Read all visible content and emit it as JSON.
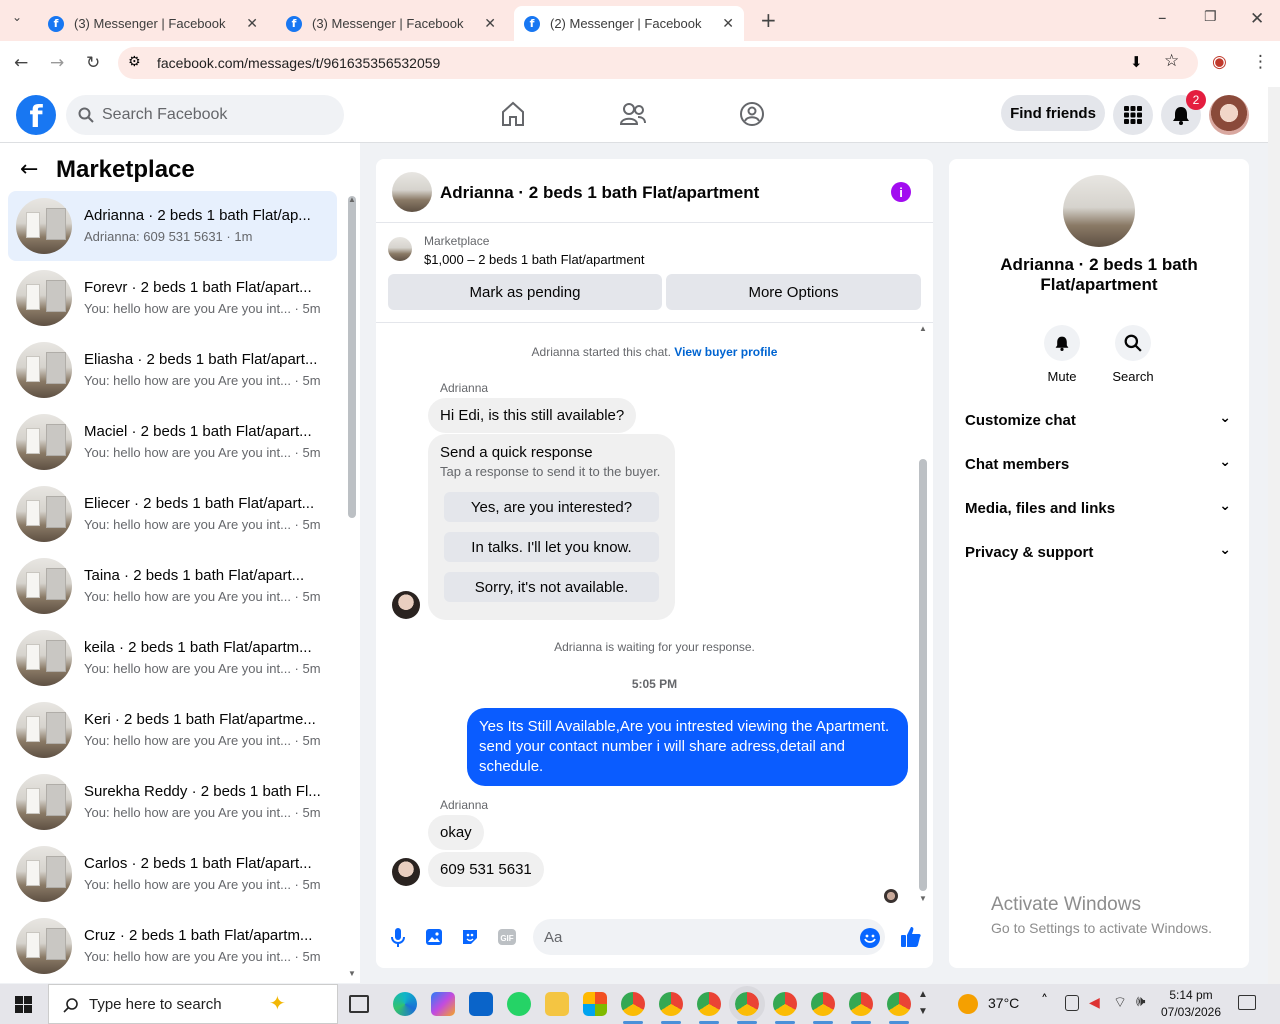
{
  "browser": {
    "tabs": [
      {
        "title": "(3) Messenger | Facebook"
      },
      {
        "title": "(3) Messenger | Facebook"
      },
      {
        "title": "(2) Messenger | Facebook"
      }
    ],
    "url": "facebook.com/messages/t/961635356532059"
  },
  "fb_header": {
    "search_placeholder": "Search Facebook",
    "find_friends_label": "Find friends",
    "notification_count": "2"
  },
  "sidebar": {
    "title": "Marketplace",
    "conversations": [
      {
        "name": "Adrianna · 2 beds 1 bath Flat/ap...",
        "preview": "Adrianna: 609 531 5631 · 1m"
      },
      {
        "name": "Forevr · 2 beds 1 bath Flat/apart...",
        "preview": "You: hello how are you Are you int... · 5m"
      },
      {
        "name": "Eliasha · 2 beds 1 bath Flat/apart...",
        "preview": "You: hello how are you Are you int... · 5m"
      },
      {
        "name": "Maciel · 2 beds 1 bath Flat/apart...",
        "preview": "You: hello how are you Are you int... · 5m"
      },
      {
        "name": "Eliecer · 2 beds 1 bath Flat/apart...",
        "preview": "You: hello how are you Are you int... · 5m"
      },
      {
        "name": "Taina · 2 beds 1 bath Flat/apart...",
        "preview": "You: hello how are you Are you int... · 5m"
      },
      {
        "name": "keila · 2 beds 1 bath Flat/apartm...",
        "preview": "You: hello how are you Are you int... · 5m"
      },
      {
        "name": "Keri · 2 beds 1 bath Flat/apartme...",
        "preview": "You: hello how are you Are you int... · 5m"
      },
      {
        "name": "Surekha Reddy · 2 beds 1 bath Fl...",
        "preview": "You: hello how are you Are you int... · 5m"
      },
      {
        "name": "Carlos · 2 beds 1 bath Flat/apart...",
        "preview": "You: hello how are you Are you int... · 5m"
      },
      {
        "name": "Cruz · 2 beds 1 bath Flat/apartm...",
        "preview": "You: hello how are you Are you int... · 5m"
      }
    ]
  },
  "chat": {
    "title": "Adrianna · 2 beds 1 bath Flat/apartment",
    "marketplace_label": "Marketplace",
    "listing": "$1,000 – 2 beds 1 bath Flat/apartment",
    "mark_pending_label": "Mark as pending",
    "more_options_label": "More Options",
    "started_text": "Adrianna started this chat.",
    "view_buyer_profile": "View buyer profile",
    "sender_name": "Adrianna",
    "first_message": "Hi Edi, is this still available?",
    "quick_response_title": "Send a quick response",
    "quick_response_sub": "Tap a response to send it to the buyer.",
    "quick_responses": [
      "Yes, are you interested?",
      "In talks. I'll let you know.",
      "Sorry, it's not available."
    ],
    "waiting_text": "Adrianna is waiting for your response.",
    "time_divider": "5:05 PM",
    "my_message": "Yes Its Still Available,Are you intrested viewing the Apartment. send your contact number i will share adress,detail and schedule.",
    "reply_1": "okay",
    "reply_2": "609 531 5631",
    "input_placeholder": "Aa"
  },
  "details": {
    "title": "Adrianna · 2 beds 1 bath Flat/apartment",
    "mute_label": "Mute",
    "search_label": "Search",
    "sections": [
      "Customize chat",
      "Chat members",
      "Media, files and links",
      "Privacy & support"
    ]
  },
  "watermark": {
    "line1": "Activate Windows",
    "line2": "Go to Settings to activate Windows."
  },
  "taskbar": {
    "search_placeholder": "Type here to search",
    "temperature": "37°C",
    "time": "5:14 pm",
    "date": "07/03/2026"
  },
  "colors": {
    "fb_blue": "#1877f2",
    "my_bubble": "#0a5cff",
    "info_purple": "#a20cf0",
    "badge_red": "#e41e3f"
  }
}
